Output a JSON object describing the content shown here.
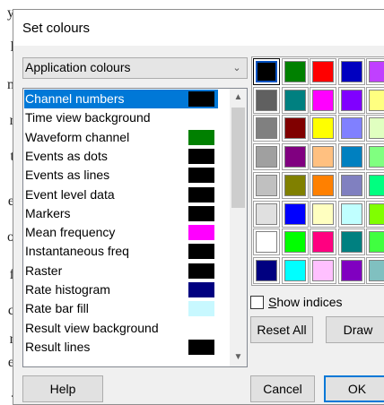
{
  "background_window": {
    "edge_letters": [
      "y",
      "l",
      "n",
      "r",
      "t",
      "e",
      "o",
      "f",
      "c",
      "r",
      "e",
      "."
    ]
  },
  "dialog": {
    "title": "Set colours",
    "colour_set_combo": {
      "selected": "Application colours"
    },
    "list": {
      "items": [
        {
          "label": "Channel numbers",
          "swatch": "#000000",
          "selected": true
        },
        {
          "label": "Time view background",
          "swatch": null
        },
        {
          "label": "Waveform channel",
          "swatch": "#008000"
        },
        {
          "label": "Events as dots",
          "swatch": "#000000"
        },
        {
          "label": "Events as lines",
          "swatch": "#000000"
        },
        {
          "label": "Event level data",
          "swatch": "#000000"
        },
        {
          "label": "Markers",
          "swatch": "#000000"
        },
        {
          "label": "Mean frequency",
          "swatch": "#ff00ff"
        },
        {
          "label": "Instantaneous freq",
          "swatch": "#000000"
        },
        {
          "label": "Raster",
          "swatch": "#000000"
        },
        {
          "label": "Rate histogram",
          "swatch": "#000080"
        },
        {
          "label": "Rate bar fill",
          "swatch": "#c8f8ff"
        },
        {
          "label": "Result view background",
          "swatch": null
        },
        {
          "label": "Result lines",
          "swatch": "#000000"
        }
      ]
    },
    "palette": {
      "rows": [
        [
          "#000000",
          "#008000",
          "#ff0000",
          "#0000c0",
          "#c040ff"
        ],
        [
          "#606060",
          "#008080",
          "#ff00ff",
          "#8000ff",
          "#ffff80"
        ],
        [
          "#808080",
          "#800000",
          "#ffff00",
          "#8080ff",
          "#e0ffc0"
        ],
        [
          "#a0a0a0",
          "#800080",
          "#ffc080",
          "#0080c0",
          "#80ff80"
        ],
        [
          "#c0c0c0",
          "#808000",
          "#ff8000",
          "#8080c0",
          "#00ff80"
        ],
        [
          "#e0e0e0",
          "#0000ff",
          "#ffffc0",
          "#c0ffff",
          "#80ff00"
        ],
        [
          "#ffffff",
          "#00ff00",
          "#ff0080",
          "#008080",
          "#40ff40"
        ],
        [
          "#000080",
          "#00ffff",
          "#ffc0ff",
          "#8000c0",
          "#80c0c0"
        ]
      ],
      "selected_row": 0,
      "selected_col": 0
    },
    "show_indices": {
      "label": "Show indices",
      "checked": false
    },
    "buttons": {
      "reset_all": "Reset All",
      "draw": "Draw",
      "help": "Help",
      "cancel": "Cancel",
      "ok": "OK"
    }
  }
}
